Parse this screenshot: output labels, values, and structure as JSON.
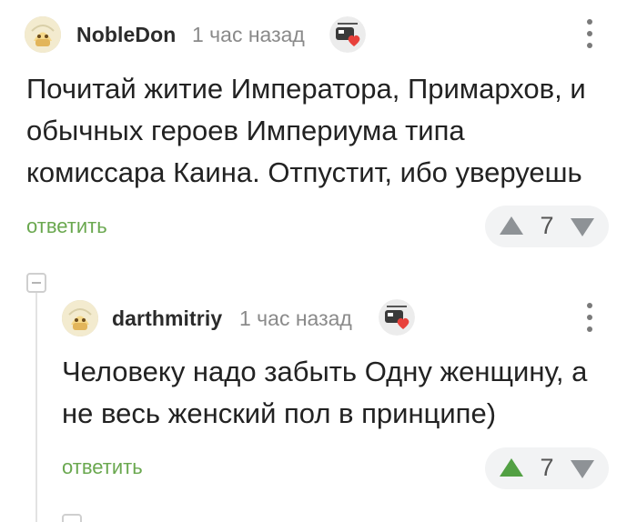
{
  "comments": [
    {
      "author": "NobleDon",
      "time": "1 час назад",
      "lines": [
        "Почитай житие Императора, Примархов, и",
        "обычных героев Империума типа",
        "комиссара Каина. Отпустит, ибо уверуешь"
      ],
      "reply_label": "ответить",
      "rating": "7",
      "upvoted": false
    },
    {
      "author": "darthmitriy",
      "time": "1 час назад",
      "lines": [
        "Человеку надо забыть Одну женщину, а",
        "не весь женский пол в принципе)"
      ],
      "reply_label": "ответить",
      "rating": "7",
      "upvoted": true
    }
  ],
  "colors": {
    "reply_green": "#6aa84f",
    "upvote_active": "#52a043",
    "vote_bg": "#f2f3f4",
    "muted": "#8a8a8a"
  },
  "icons": {
    "avatar": "user-avatar-icon",
    "badge": "heart-badge-icon",
    "more": "more-vertical-icon",
    "upvote": "arrow-up-icon",
    "downvote": "arrow-down-icon",
    "collapse": "collapse-thread-icon"
  }
}
